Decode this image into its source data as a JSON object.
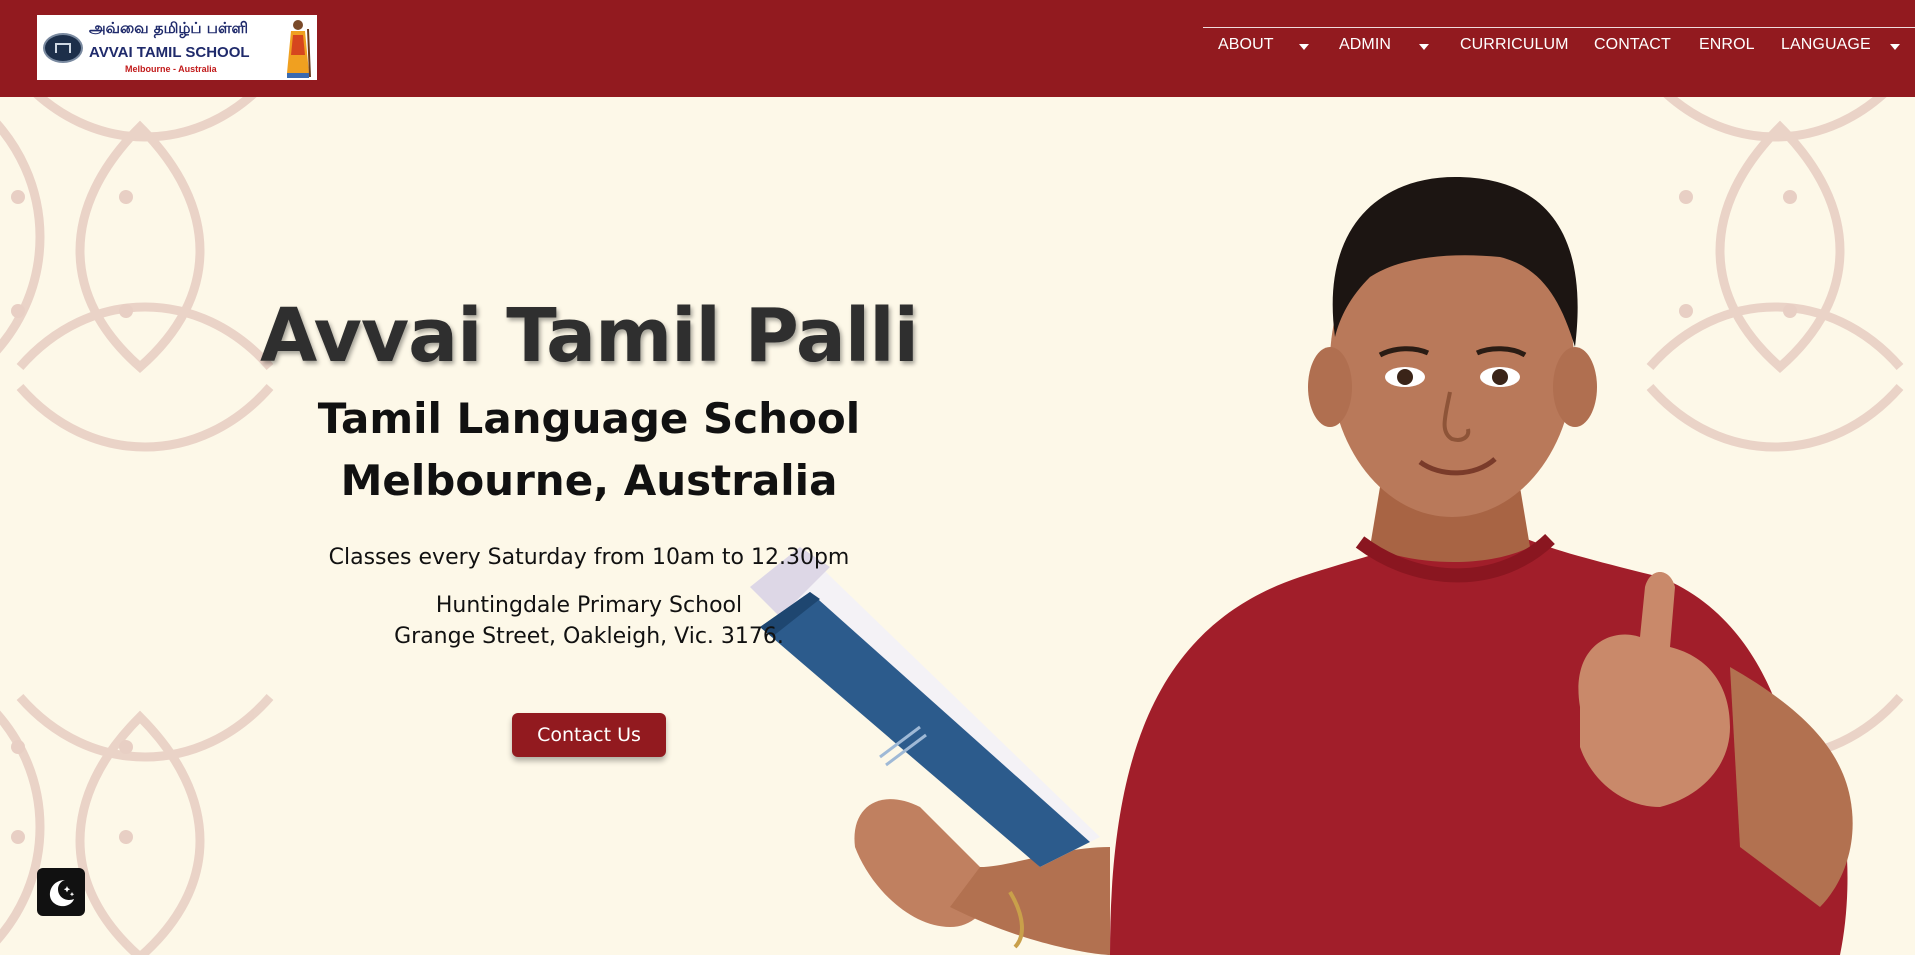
{
  "header": {
    "logo": {
      "tamil_text": "அவ்வை தமிழ்ப் பள்ளி",
      "name": "AVVAI TAMIL SCHOOL",
      "city": "Melbourne - Australia"
    },
    "nav": [
      {
        "label": "ABOUT",
        "has_dropdown": true
      },
      {
        "label": "ADMIN",
        "has_dropdown": true
      },
      {
        "label": "CURRICULUM",
        "has_dropdown": false
      },
      {
        "label": "CONTACT",
        "has_dropdown": false
      },
      {
        "label": "ENROL",
        "has_dropdown": false
      },
      {
        "label": "LANGUAGE",
        "has_dropdown": true
      }
    ]
  },
  "hero": {
    "title": "Avvai Tamil Palli",
    "subtitle_line1": "Tamil Language School",
    "subtitle_line2": "Melbourne, Australia",
    "classes": "Classes every Saturday from 10am to 12.30pm",
    "address_line1": "Huntingdale Primary School",
    "address_line2": "Grange Street, Oakleigh, Vic. 3176.",
    "cta_label": "Contact Us"
  },
  "colors": {
    "brand": "#921a1f",
    "background": "#fdf8e8",
    "pattern": "#e8cfc4"
  },
  "icons": {
    "dark_mode_toggle": "moon-stars-icon"
  }
}
